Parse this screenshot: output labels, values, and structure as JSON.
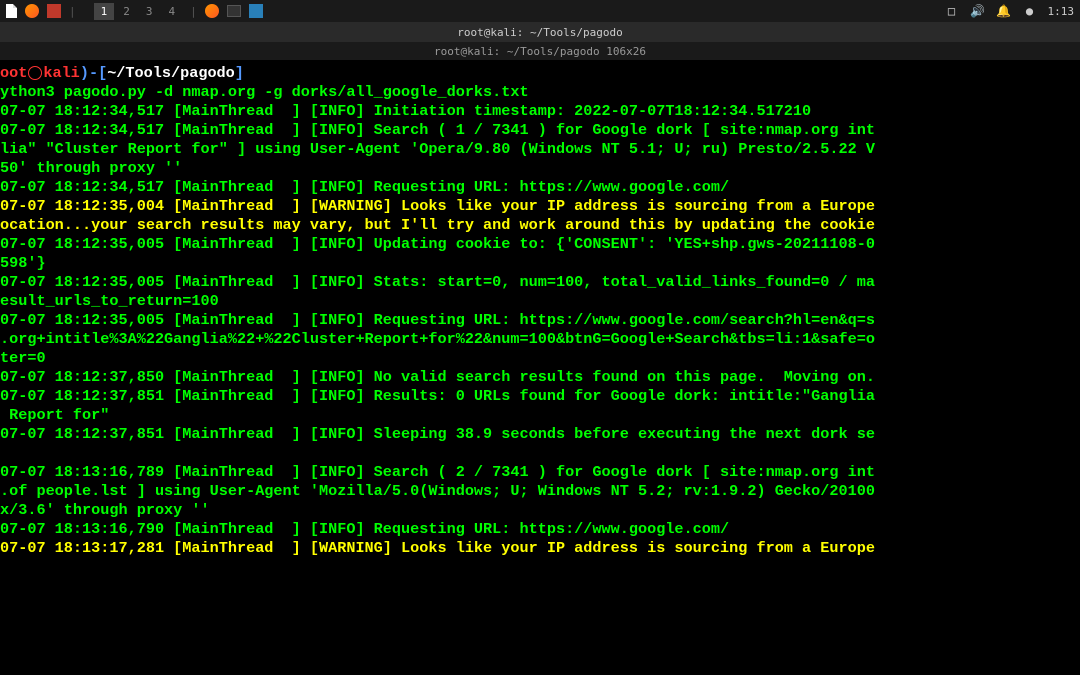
{
  "panel": {
    "workspaces": [
      "1",
      "2",
      "3",
      "4"
    ],
    "active_workspace": 0,
    "time": "1:13"
  },
  "window": {
    "title": "root@kali: ~/Tools/pagodo",
    "subtitle": "root@kali: ~/Tools/pagodo 106x26"
  },
  "prompt": {
    "user": "oot",
    "host": "kali",
    "path": "~/Tools/pagodo"
  },
  "command": "ython3 pagodo.py -d nmap.org -g dorks/all_google_dorks.txt",
  "log_lines": [
    "07-07 18:12:34,517 [MainThread  ] [INFO] Initiation timestamp: 2022-07-07T18:12:34.517210",
    "07-07 18:12:34,517 [MainThread  ] [INFO] Search ( 1 / 7341 ) for Google dork [ site:nmap.org int",
    "lia\" \"Cluster Report for\" ] using User-Agent 'Opera/9.80 (Windows NT 5.1; U; ru) Presto/2.5.22 V",
    "50' through proxy ''",
    "07-07 18:12:34,517 [MainThread  ] [INFO] Requesting URL: https://www.google.com/",
    "07-07 18:12:35,004 [MainThread  ] [WARNING] Looks like your IP address is sourcing from a Europe",
    "ocation...your search results may vary, but I'll try and work around this by updating the cookie",
    "07-07 18:12:35,005 [MainThread  ] [INFO] Updating cookie to: {'CONSENT': 'YES+shp.gws-20211108-0",
    "598'}",
    "07-07 18:12:35,005 [MainThread  ] [INFO] Stats: start=0, num=100, total_valid_links_found=0 / ma",
    "esult_urls_to_return=100",
    "07-07 18:12:35,005 [MainThread  ] [INFO] Requesting URL: https://www.google.com/search?hl=en&q=s",
    ".org+intitle%3A%22Ganglia%22+%22Cluster+Report+for%22&num=100&btnG=Google+Search&tbs=li:1&safe=o",
    "ter=0",
    "07-07 18:12:37,850 [MainThread  ] [INFO] No valid search results found on this page.  Moving on.",
    "07-07 18:12:37,851 [MainThread  ] [INFO] Results: 0 URLs found for Google dork: intitle:\"Ganglia",
    " Report for\"",
    "07-07 18:12:37,851 [MainThread  ] [INFO] Sleeping 38.9 seconds before executing the next dork se",
    "",
    "07-07 18:13:16,789 [MainThread  ] [INFO] Search ( 2 / 7341 ) for Google dork [ site:nmap.org int",
    ".of people.lst ] using User-Agent 'Mozilla/5.0(Windows; U; Windows NT 5.2; rv:1.9.2) Gecko/20100",
    "x/3.6' through proxy ''",
    "07-07 18:13:16,790 [MainThread  ] [INFO] Requesting URL: https://www.google.com/",
    "07-07 18:13:17,281 [MainThread  ] [WARNING] Looks like your IP address is sourcing from a Europe"
  ],
  "warning_indices": [
    5,
    6,
    23
  ],
  "icons": {
    "record": "●",
    "speaker": "🔊",
    "bell": "🔔",
    "power": "⏻",
    "square": "□"
  }
}
